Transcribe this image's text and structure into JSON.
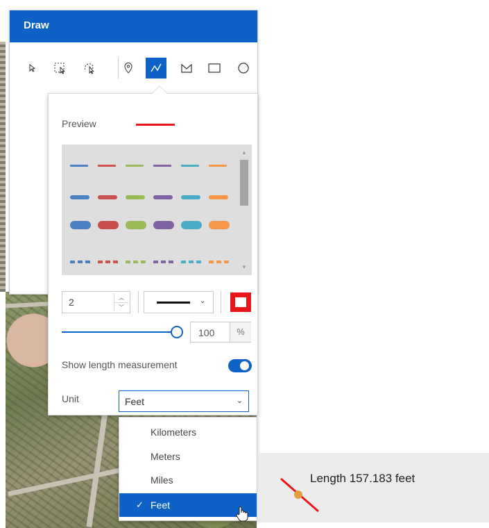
{
  "draw": {
    "title": "Draw",
    "tools": [
      {
        "name": "select-tool",
        "icon": "arrow-pointer-icon"
      },
      {
        "name": "rectangle-select-tool",
        "icon": "rectangle-select-icon"
      },
      {
        "name": "lasso-select-tool",
        "icon": "lasso-select-icon"
      },
      {
        "name": "point-tool",
        "icon": "pin-icon"
      },
      {
        "name": "polyline-tool",
        "icon": "polyline-icon",
        "active": true
      },
      {
        "name": "polygon-tool",
        "icon": "polygon-icon"
      },
      {
        "name": "rectangle-tool",
        "icon": "rectangle-icon"
      },
      {
        "name": "circle-tool",
        "icon": "circle-icon"
      }
    ]
  },
  "symbol": {
    "preview_label": "Preview",
    "preview_color": "#e8161b",
    "palette_colors": [
      "#4a7fc1",
      "#c9504c",
      "#9bbb59",
      "#8064a2",
      "#4bacc6",
      "#f79646"
    ],
    "width_value": "2",
    "opacity_value": "100",
    "opacity_unit": "%",
    "opacity_level": 1.0,
    "outline_color": "#e8161b",
    "show_length_label": "Show length measurement",
    "show_length_enabled": true,
    "unit_label": "Unit",
    "unit_selected": "Feet",
    "unit_options": [
      "Kilometers",
      "Meters",
      "Miles",
      "Feet"
    ]
  },
  "measurement": {
    "text": "Length 157.183 feet",
    "line_color": "#e8161b",
    "vertex_color": "#e0a040"
  },
  "accent_color": "#0f62c5"
}
